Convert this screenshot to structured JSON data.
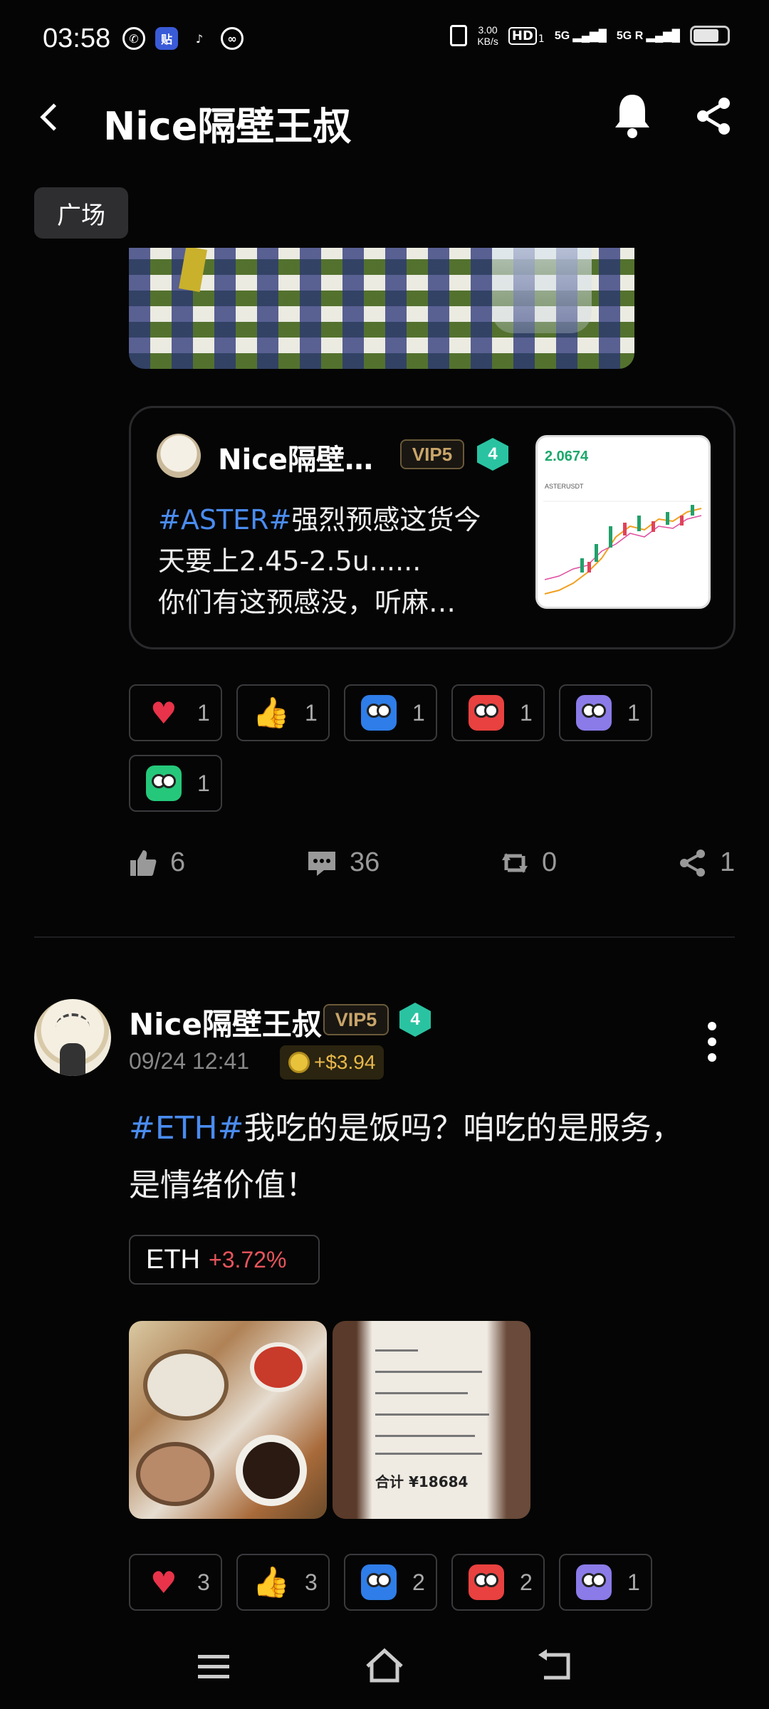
{
  "status_bar": {
    "time": "03:58",
    "net_speed_top": "3.00",
    "net_speed_unit": "KB/s",
    "hd": "HD",
    "hd_sub": "1",
    "sim1": "5G",
    "sim2": "5G",
    "sim2_roam": "R",
    "battery_level": 0.75
  },
  "header": {
    "title": "Nice隔壁王叔"
  },
  "section_tag": "广场",
  "quote": {
    "name": "Nice隔壁…",
    "vip": "VIP5",
    "level": "4",
    "hashtag": "#ASTER#",
    "line1_rest": "强烈预感这货今",
    "line2": "天要上2.45-2.5u......",
    "line3": "你们有这预感没，听麻…",
    "chart_price": "2.0674",
    "chart_symbol": "ASTERUSDT"
  },
  "reactions_top": [
    {
      "icon": "heart-icon",
      "count": "1"
    },
    {
      "icon": "thumbs-up-icon",
      "count": "1"
    },
    {
      "icon": "hodl-face-icon",
      "count": "1"
    },
    {
      "icon": "angry-face-icon",
      "count": "1"
    },
    {
      "icon": "grimace-face-icon",
      "count": "1"
    },
    {
      "icon": "thinking-face-icon",
      "count": "1"
    }
  ],
  "actions": {
    "likes": "6",
    "comments": "36",
    "reposts": "0",
    "shares": "1"
  },
  "post": {
    "author": "Nice隔壁王叔",
    "vip": "VIP5",
    "level": "4",
    "date": "09/24 12:41",
    "tip": "+$3.94",
    "hashtag": "#ETH#",
    "text_rest": "我吃的是饭吗？咱吃的是服务，",
    "text_line2": "是情绪价值！",
    "coin_symbol": "ETH",
    "coin_change": "+3.72%",
    "receipt_total": "合计 ¥18684"
  },
  "reactions_bottom": [
    {
      "icon": "heart-icon",
      "count": "3"
    },
    {
      "icon": "thumbs-up-icon",
      "count": "3"
    },
    {
      "icon": "hodl-face-icon",
      "count": "2"
    },
    {
      "icon": "angry-face-icon",
      "count": "2"
    },
    {
      "icon": "grimace-face-icon",
      "count": "1"
    }
  ]
}
